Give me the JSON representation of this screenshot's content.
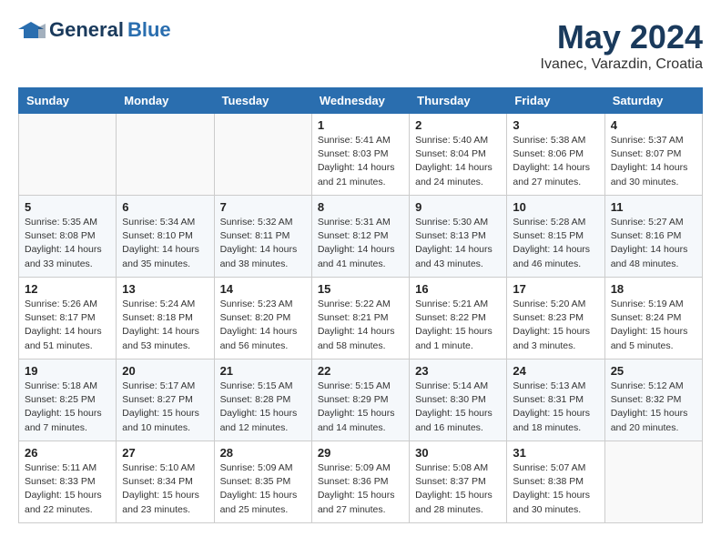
{
  "header": {
    "logo_general": "General",
    "logo_blue": "Blue",
    "month_title": "May 2024",
    "location": "Ivanec, Varazdin, Croatia"
  },
  "weekdays": [
    "Sunday",
    "Monday",
    "Tuesday",
    "Wednesday",
    "Thursday",
    "Friday",
    "Saturday"
  ],
  "weeks": [
    [
      {
        "day": "",
        "sunrise": "",
        "sunset": "",
        "daylight": ""
      },
      {
        "day": "",
        "sunrise": "",
        "sunset": "",
        "daylight": ""
      },
      {
        "day": "",
        "sunrise": "",
        "sunset": "",
        "daylight": ""
      },
      {
        "day": "1",
        "sunrise": "Sunrise: 5:41 AM",
        "sunset": "Sunset: 8:03 PM",
        "daylight": "Daylight: 14 hours and 21 minutes."
      },
      {
        "day": "2",
        "sunrise": "Sunrise: 5:40 AM",
        "sunset": "Sunset: 8:04 PM",
        "daylight": "Daylight: 14 hours and 24 minutes."
      },
      {
        "day": "3",
        "sunrise": "Sunrise: 5:38 AM",
        "sunset": "Sunset: 8:06 PM",
        "daylight": "Daylight: 14 hours and 27 minutes."
      },
      {
        "day": "4",
        "sunrise": "Sunrise: 5:37 AM",
        "sunset": "Sunset: 8:07 PM",
        "daylight": "Daylight: 14 hours and 30 minutes."
      }
    ],
    [
      {
        "day": "5",
        "sunrise": "Sunrise: 5:35 AM",
        "sunset": "Sunset: 8:08 PM",
        "daylight": "Daylight: 14 hours and 33 minutes."
      },
      {
        "day": "6",
        "sunrise": "Sunrise: 5:34 AM",
        "sunset": "Sunset: 8:10 PM",
        "daylight": "Daylight: 14 hours and 35 minutes."
      },
      {
        "day": "7",
        "sunrise": "Sunrise: 5:32 AM",
        "sunset": "Sunset: 8:11 PM",
        "daylight": "Daylight: 14 hours and 38 minutes."
      },
      {
        "day": "8",
        "sunrise": "Sunrise: 5:31 AM",
        "sunset": "Sunset: 8:12 PM",
        "daylight": "Daylight: 14 hours and 41 minutes."
      },
      {
        "day": "9",
        "sunrise": "Sunrise: 5:30 AM",
        "sunset": "Sunset: 8:13 PM",
        "daylight": "Daylight: 14 hours and 43 minutes."
      },
      {
        "day": "10",
        "sunrise": "Sunrise: 5:28 AM",
        "sunset": "Sunset: 8:15 PM",
        "daylight": "Daylight: 14 hours and 46 minutes."
      },
      {
        "day": "11",
        "sunrise": "Sunrise: 5:27 AM",
        "sunset": "Sunset: 8:16 PM",
        "daylight": "Daylight: 14 hours and 48 minutes."
      }
    ],
    [
      {
        "day": "12",
        "sunrise": "Sunrise: 5:26 AM",
        "sunset": "Sunset: 8:17 PM",
        "daylight": "Daylight: 14 hours and 51 minutes."
      },
      {
        "day": "13",
        "sunrise": "Sunrise: 5:24 AM",
        "sunset": "Sunset: 8:18 PM",
        "daylight": "Daylight: 14 hours and 53 minutes."
      },
      {
        "day": "14",
        "sunrise": "Sunrise: 5:23 AM",
        "sunset": "Sunset: 8:20 PM",
        "daylight": "Daylight: 14 hours and 56 minutes."
      },
      {
        "day": "15",
        "sunrise": "Sunrise: 5:22 AM",
        "sunset": "Sunset: 8:21 PM",
        "daylight": "Daylight: 14 hours and 58 minutes."
      },
      {
        "day": "16",
        "sunrise": "Sunrise: 5:21 AM",
        "sunset": "Sunset: 8:22 PM",
        "daylight": "Daylight: 15 hours and 1 minute."
      },
      {
        "day": "17",
        "sunrise": "Sunrise: 5:20 AM",
        "sunset": "Sunset: 8:23 PM",
        "daylight": "Daylight: 15 hours and 3 minutes."
      },
      {
        "day": "18",
        "sunrise": "Sunrise: 5:19 AM",
        "sunset": "Sunset: 8:24 PM",
        "daylight": "Daylight: 15 hours and 5 minutes."
      }
    ],
    [
      {
        "day": "19",
        "sunrise": "Sunrise: 5:18 AM",
        "sunset": "Sunset: 8:25 PM",
        "daylight": "Daylight: 15 hours and 7 minutes."
      },
      {
        "day": "20",
        "sunrise": "Sunrise: 5:17 AM",
        "sunset": "Sunset: 8:27 PM",
        "daylight": "Daylight: 15 hours and 10 minutes."
      },
      {
        "day": "21",
        "sunrise": "Sunrise: 5:15 AM",
        "sunset": "Sunset: 8:28 PM",
        "daylight": "Daylight: 15 hours and 12 minutes."
      },
      {
        "day": "22",
        "sunrise": "Sunrise: 5:15 AM",
        "sunset": "Sunset: 8:29 PM",
        "daylight": "Daylight: 15 hours and 14 minutes."
      },
      {
        "day": "23",
        "sunrise": "Sunrise: 5:14 AM",
        "sunset": "Sunset: 8:30 PM",
        "daylight": "Daylight: 15 hours and 16 minutes."
      },
      {
        "day": "24",
        "sunrise": "Sunrise: 5:13 AM",
        "sunset": "Sunset: 8:31 PM",
        "daylight": "Daylight: 15 hours and 18 minutes."
      },
      {
        "day": "25",
        "sunrise": "Sunrise: 5:12 AM",
        "sunset": "Sunset: 8:32 PM",
        "daylight": "Daylight: 15 hours and 20 minutes."
      }
    ],
    [
      {
        "day": "26",
        "sunrise": "Sunrise: 5:11 AM",
        "sunset": "Sunset: 8:33 PM",
        "daylight": "Daylight: 15 hours and 22 minutes."
      },
      {
        "day": "27",
        "sunrise": "Sunrise: 5:10 AM",
        "sunset": "Sunset: 8:34 PM",
        "daylight": "Daylight: 15 hours and 23 minutes."
      },
      {
        "day": "28",
        "sunrise": "Sunrise: 5:09 AM",
        "sunset": "Sunset: 8:35 PM",
        "daylight": "Daylight: 15 hours and 25 minutes."
      },
      {
        "day": "29",
        "sunrise": "Sunrise: 5:09 AM",
        "sunset": "Sunset: 8:36 PM",
        "daylight": "Daylight: 15 hours and 27 minutes."
      },
      {
        "day": "30",
        "sunrise": "Sunrise: 5:08 AM",
        "sunset": "Sunset: 8:37 PM",
        "daylight": "Daylight: 15 hours and 28 minutes."
      },
      {
        "day": "31",
        "sunrise": "Sunrise: 5:07 AM",
        "sunset": "Sunset: 8:38 PM",
        "daylight": "Daylight: 15 hours and 30 minutes."
      },
      {
        "day": "",
        "sunrise": "",
        "sunset": "",
        "daylight": ""
      }
    ]
  ]
}
